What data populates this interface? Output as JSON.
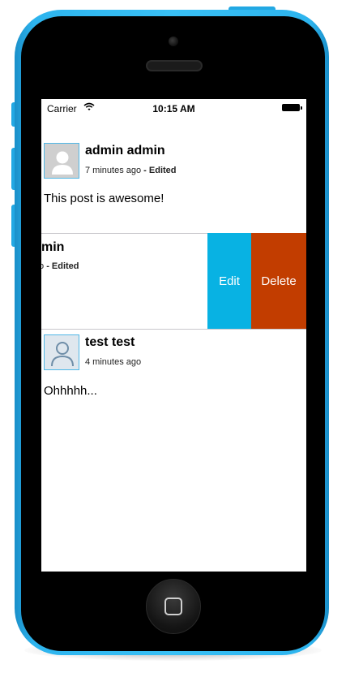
{
  "status_bar": {
    "carrier": "Carrier",
    "time": "10:15 AM",
    "icons": [
      "wifi-icon",
      "battery-icon"
    ]
  },
  "posts": [
    {
      "author": "admin admin",
      "time_ago": "7 minutes ago",
      "edited_label": "- Edited",
      "body": "This post is awesome!",
      "avatar_icon": "person-icon"
    },
    {
      "author": "admin admin",
      "visible_author_fragment": "min",
      "visible_meta_fragment": "o",
      "edited_label": "- Edited",
      "swiped": true,
      "actions": [
        {
          "label": "Edit",
          "color": "#08b2e3"
        },
        {
          "label": "Delete",
          "color": "#c23d00"
        }
      ]
    },
    {
      "author": "test test",
      "time_ago": "4 minutes ago",
      "body": "Ohhhhh...",
      "avatar_icon": "person-outline-icon"
    }
  ],
  "colors": {
    "device_frame": "#39c0f5",
    "avatar_border": "#4fb7e6",
    "edit_action": "#08b2e3",
    "delete_action": "#c23d00",
    "separator": "#c8c7cc"
  }
}
